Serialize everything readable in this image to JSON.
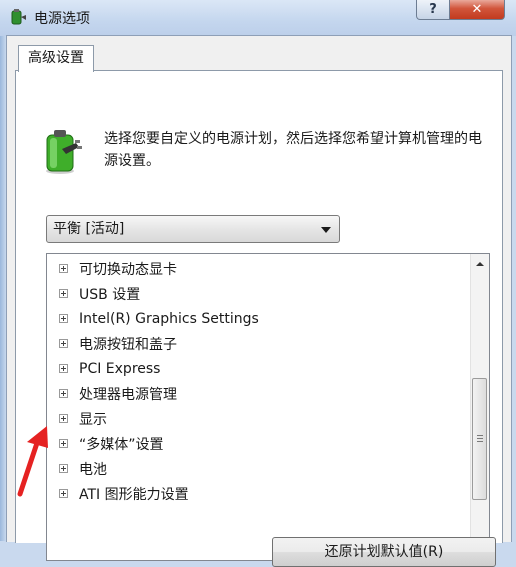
{
  "window": {
    "title": "电源选项",
    "help_label": "?",
    "close_label": "✕"
  },
  "tabs": [
    {
      "label": "高级设置"
    }
  ],
  "description": "选择您要自定义的电源计划，然后选择您希望计算机管理的电源设置。",
  "plan_select": {
    "selected": "平衡 [活动]"
  },
  "settings_tree": [
    {
      "label": "可切换动态显卡"
    },
    {
      "label": "USB 设置"
    },
    {
      "label": "Intel(R) Graphics Settings"
    },
    {
      "label": "电源按钮和盖子"
    },
    {
      "label": "PCI Express"
    },
    {
      "label": "处理器电源管理"
    },
    {
      "label": "显示"
    },
    {
      "label": "“多媒体”设置"
    },
    {
      "label": "电池"
    },
    {
      "label": "ATI 图形能力设置"
    }
  ],
  "buttons": {
    "restore_defaults": "还原计划默认值(R)"
  },
  "icons": {
    "app": "power-battery-icon",
    "battery": "battery-plug-icon",
    "annotation": "red-arrow-icon"
  },
  "colors": {
    "close_button": "#c23a1f",
    "annotation_arrow": "#e52222",
    "battery_green": "#3fae2a"
  }
}
